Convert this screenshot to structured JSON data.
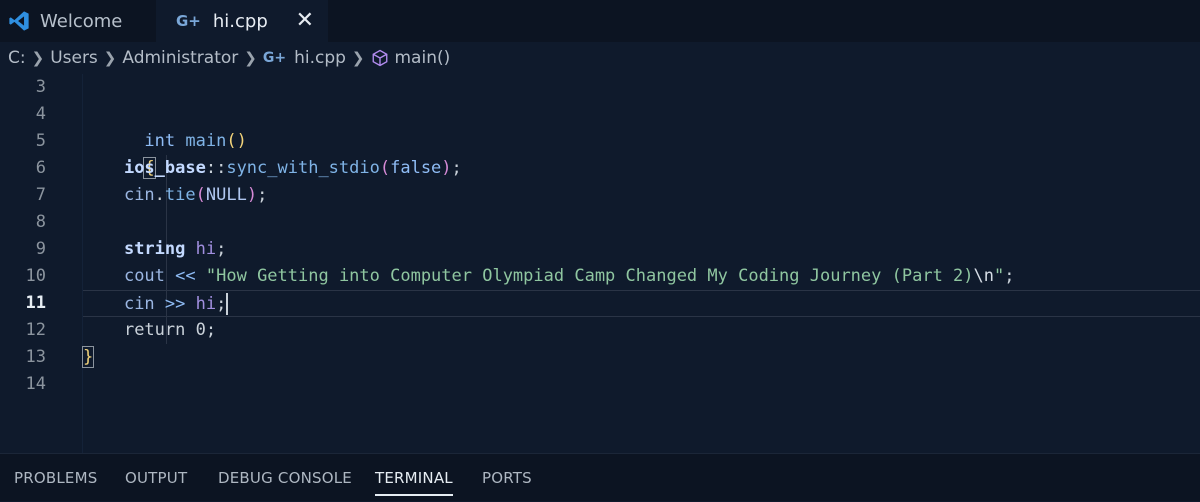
{
  "tabs": [
    {
      "label": "Welcome",
      "active": false
    },
    {
      "label": "hi.cpp",
      "active": true
    }
  ],
  "breadcrumb": {
    "drive": "C:",
    "users": "Users",
    "admin": "Administrator",
    "file": "hi.cpp",
    "symbol": "main()"
  },
  "editor": {
    "current_line": 11,
    "lines": [
      {
        "n": "3"
      },
      {
        "n": "4",
        "t": [
          "int",
          "main",
          "(",
          ")"
        ]
      },
      {
        "n": "5",
        "t": [
          "{"
        ]
      },
      {
        "n": "6",
        "t": [
          "ios_base",
          "::",
          "sync_with_stdio",
          "(",
          "false",
          ")",
          ";"
        ]
      },
      {
        "n": "7",
        "t": [
          "cin",
          ".",
          "tie",
          "(",
          "NULL",
          ")",
          ";"
        ]
      },
      {
        "n": "8"
      },
      {
        "n": "9",
        "t": [
          "string",
          "hi",
          ";"
        ]
      },
      {
        "n": "10",
        "t": [
          "cout",
          "<<",
          "\"How Getting into Computer Olympiad Camp Changed My Coding Journey (Part 2)",
          "\\n",
          "\"",
          ";"
        ]
      },
      {
        "n": "11",
        "t": [
          "cin",
          ">>",
          "hi",
          ";"
        ]
      },
      {
        "n": "12",
        "t": [
          "return",
          "0",
          ";"
        ]
      },
      {
        "n": "13",
        "t": [
          "}"
        ]
      },
      {
        "n": "14"
      }
    ]
  },
  "panel": {
    "tabs": [
      "PROBLEMS",
      "OUTPUT",
      "DEBUG CONSOLE",
      "TERMINAL",
      "PORTS"
    ],
    "active": "TERMINAL"
  }
}
